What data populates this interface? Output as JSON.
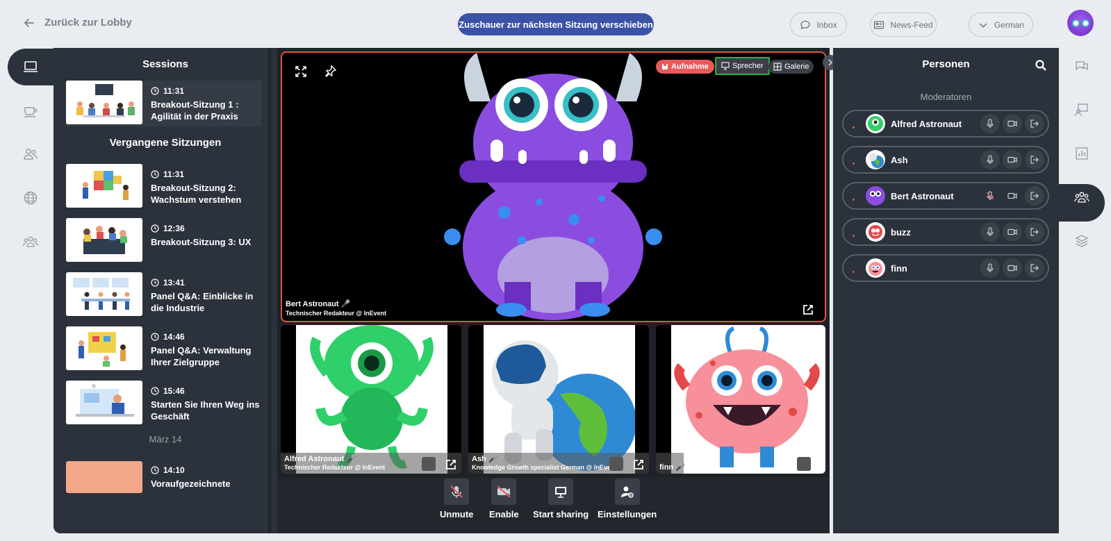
{
  "topbar": {
    "back_label": "Zurück zur Lobby",
    "move_button": "Zuschauer zur nächsten Sitzung verschieben",
    "inbox": "Inbox",
    "newsfeed": "News-Feed",
    "language": "German"
  },
  "sessions": {
    "title": "Sessions",
    "current": {
      "time": "11:31",
      "name": "Breakout-Sitzung 1 : Agilität in der Praxis"
    },
    "past_title": "Vergangene Sitzungen",
    "past": [
      {
        "time": "11:31",
        "name": "Breakout-Sitzung 2: Wachstum verstehen"
      },
      {
        "time": "12:36",
        "name": "Breakout-Sitzung 3: UX"
      },
      {
        "time": "13:41",
        "name": "Panel Q&A: Einblicke in die Industrie"
      },
      {
        "time": "14:46",
        "name": "Panel Q&A: Verwaltung Ihrer Zielgruppe"
      },
      {
        "time": "15:46",
        "name": "Starten Sie Ihren Weg ins Geschäft"
      }
    ],
    "date_label": "März 14",
    "upcoming": {
      "time": "14:10",
      "name": "Voraufgezeichnete"
    }
  },
  "stage": {
    "record_label": "Aufnahme",
    "speaker_view": "Sprecher",
    "gallery_view": "Galerie",
    "main_speaker": {
      "name": "Bert Astronaut",
      "title": "Technischer Redakteur @ InEvent"
    },
    "tiles": [
      {
        "name": "Alfred Astronaut",
        "title": "Technischer Redakteur @ InEvent"
      },
      {
        "name": "Ash",
        "title": "Knowledge Growth specialist German @ InEvent"
      },
      {
        "name": "finn",
        "title": ""
      }
    ],
    "toolbar": {
      "unmute": "Unmute",
      "enable": "Enable",
      "share": "Start sharing",
      "settings": "Einstellungen"
    }
  },
  "people": {
    "title": "Personen",
    "moderators_label": "Moderatoren",
    "list": [
      {
        "name": "Alfred Astronaut"
      },
      {
        "name": "Ash"
      },
      {
        "name": "Bert Astronaut"
      },
      {
        "name": "buzz"
      },
      {
        "name": "finn"
      }
    ]
  },
  "colors": {
    "accent_blue": "#3c52a6",
    "record_red": "#e95a5a",
    "speaker_border": "#e0533a",
    "selected_green": "#2bb34a",
    "panel_dark": "#2c323b"
  }
}
